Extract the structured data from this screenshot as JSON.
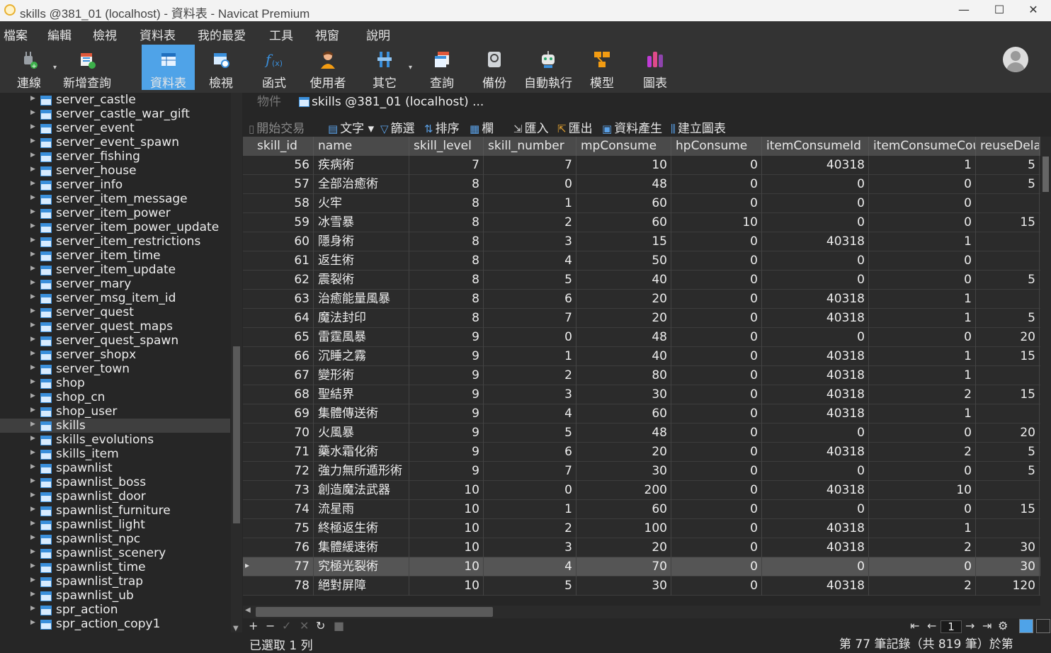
{
  "window": {
    "title": "skills @381_01 (localhost) - 資料表 - Navicat Premium",
    "minimize": "—",
    "maximize": "☐",
    "close": "✕"
  },
  "menu": [
    "檔案",
    "編輯",
    "檢視",
    "資料表",
    "我的最愛",
    "工具",
    "視窗",
    "說明"
  ],
  "toolbar": {
    "connect": "連線",
    "new_query": "新增查詢",
    "table": "資料表",
    "view": "檢視",
    "function": "函式",
    "user": "使用者",
    "other": "其它",
    "query": "查詢",
    "backup": "備份",
    "automation": "自動執行",
    "model": "模型",
    "chart": "圖表"
  },
  "sidebar": {
    "items": [
      "server_castle",
      "server_castle_war_gift",
      "server_event",
      "server_event_spawn",
      "server_fishing",
      "server_house",
      "server_info",
      "server_item_message",
      "server_item_power",
      "server_item_power_update",
      "server_item_restrictions",
      "server_item_time",
      "server_item_update",
      "server_mary",
      "server_msg_item_id",
      "server_quest",
      "server_quest_maps",
      "server_quest_spawn",
      "server_shopx",
      "server_town",
      "shop",
      "shop_cn",
      "shop_user",
      "skills",
      "skills_evolutions",
      "skills_item",
      "spawnlist",
      "spawnlist_boss",
      "spawnlist_door",
      "spawnlist_furniture",
      "spawnlist_light",
      "spawnlist_npc",
      "spawnlist_scenery",
      "spawnlist_time",
      "spawnlist_trap",
      "spawnlist_ub",
      "spr_action",
      "spr_action_copy1"
    ],
    "selected": "skills"
  },
  "tabs": {
    "objects": "物件",
    "active": "skills @381_01 (localhost) ..."
  },
  "table_toolbar": {
    "begin_transaction": "開始交易",
    "text": "文字",
    "filter": "篩選",
    "sort": "排序",
    "columns": "欄",
    "import": "匯入",
    "export": "匯出",
    "data_generation": "資料產生",
    "create_chart": "建立圖表"
  },
  "grid": {
    "columns": [
      "skill_id",
      "name",
      "skill_level",
      "skill_number",
      "mpConsume",
      "hpConsume",
      "itemConsumeId",
      "itemConsumeCou",
      "reuseDela"
    ],
    "rows": [
      [
        "56",
        "疾病術",
        "7",
        "7",
        "10",
        "0",
        "40318",
        "1",
        "5"
      ],
      [
        "57",
        "全部治癒術",
        "8",
        "0",
        "48",
        "0",
        "0",
        "0",
        "5"
      ],
      [
        "58",
        "火牢",
        "8",
        "1",
        "60",
        "0",
        "0",
        "0",
        ""
      ],
      [
        "59",
        "冰雪暴",
        "8",
        "2",
        "60",
        "10",
        "0",
        "0",
        "15"
      ],
      [
        "60",
        "隱身術",
        "8",
        "3",
        "15",
        "0",
        "40318",
        "1",
        ""
      ],
      [
        "61",
        "返生術",
        "8",
        "4",
        "50",
        "0",
        "0",
        "0",
        ""
      ],
      [
        "62",
        "震裂術",
        "8",
        "5",
        "40",
        "0",
        "0",
        "0",
        "5"
      ],
      [
        "63",
        "治癒能量風暴",
        "8",
        "6",
        "20",
        "0",
        "40318",
        "1",
        ""
      ],
      [
        "64",
        "魔法封印",
        "8",
        "7",
        "20",
        "0",
        "40318",
        "1",
        "5"
      ],
      [
        "65",
        "雷霆風暴",
        "9",
        "0",
        "48",
        "0",
        "0",
        "0",
        "20"
      ],
      [
        "66",
        "沉睡之霧",
        "9",
        "1",
        "40",
        "0",
        "40318",
        "1",
        "15"
      ],
      [
        "67",
        "變形術",
        "9",
        "2",
        "80",
        "0",
        "40318",
        "1",
        ""
      ],
      [
        "68",
        "聖結界",
        "9",
        "3",
        "30",
        "0",
        "40318",
        "2",
        "15"
      ],
      [
        "69",
        "集體傳送術",
        "9",
        "4",
        "60",
        "0",
        "40318",
        "1",
        ""
      ],
      [
        "70",
        "火風暴",
        "9",
        "5",
        "48",
        "0",
        "0",
        "0",
        "20"
      ],
      [
        "71",
        "藥水霜化術",
        "9",
        "6",
        "20",
        "0",
        "40318",
        "2",
        "5"
      ],
      [
        "72",
        "強力無所遁形術",
        "9",
        "7",
        "30",
        "0",
        "0",
        "0",
        "5"
      ],
      [
        "73",
        "創造魔法武器",
        "10",
        "0",
        "200",
        "0",
        "40318",
        "10",
        ""
      ],
      [
        "74",
        "流星雨",
        "10",
        "1",
        "60",
        "0",
        "0",
        "0",
        "15"
      ],
      [
        "75",
        "終極返生術",
        "10",
        "2",
        "100",
        "0",
        "40318",
        "1",
        ""
      ],
      [
        "76",
        "集體緩速術",
        "10",
        "3",
        "20",
        "0",
        "40318",
        "2",
        "30"
      ],
      [
        "77",
        "究極光裂術",
        "10",
        "4",
        "70",
        "0",
        "0",
        "0",
        "30"
      ],
      [
        "78",
        "絕對屏障",
        "10",
        "5",
        "30",
        "0",
        "40318",
        "2",
        "120"
      ]
    ],
    "selected_row": 21
  },
  "pager": {
    "page": "1"
  },
  "status": {
    "selection": "已選取 1 列",
    "record": "第 77 筆記錄（共 819 筆）於第"
  },
  "colors": {
    "accent": "#4fa3e8",
    "background": "#262626",
    "header": "#4a4a4a"
  }
}
